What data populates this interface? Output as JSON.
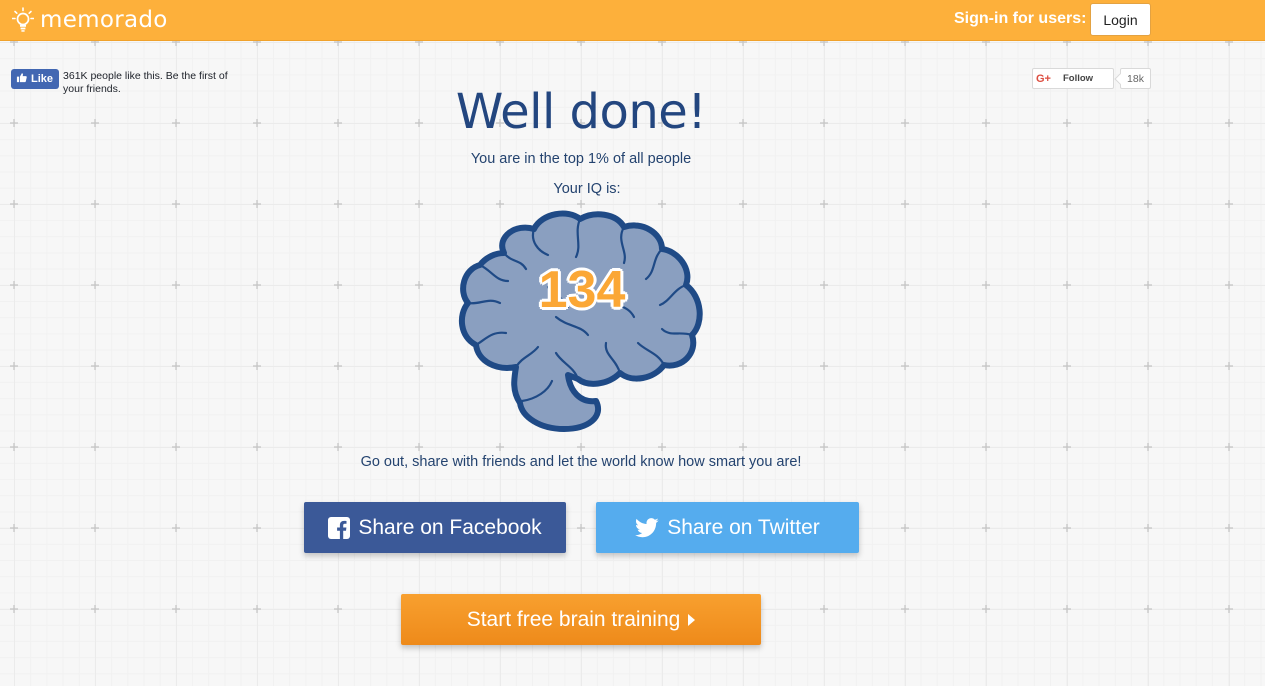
{
  "header": {
    "logo_text": "memorado",
    "signin_label": "Sign-in for users:",
    "login_label": "Login"
  },
  "facebook_like": {
    "button_label": "Like",
    "text": "361K people like this. Be the first of your friends."
  },
  "google_plus": {
    "logo": "G+",
    "follow_label": "Follow",
    "count": "18k"
  },
  "result": {
    "title": "Well done!",
    "subtitle": "You are in the top 1% of all people",
    "iq_label": "Your IQ is:",
    "iq_score": "134",
    "share_message": "Go out, share with friends and let the world know how smart you are!"
  },
  "actions": {
    "facebook_label": "Share on Facebook",
    "twitter_label": "Share on Twitter",
    "training_label": "Start free brain training"
  },
  "colors": {
    "header_bg": "#fdb03b",
    "facebook": "#3b5998",
    "twitter": "#55acee",
    "training": "#f39423",
    "iq_score": "#fba735",
    "brain_fill": "#8a9fc0",
    "brain_outline": "#1f4a86"
  },
  "icons": {
    "logo": "lightbulb-icon",
    "facebook": "facebook-icon",
    "twitter": "twitter-bird-icon",
    "like": "thumbs-up-icon",
    "training": "caret-right-icon"
  }
}
